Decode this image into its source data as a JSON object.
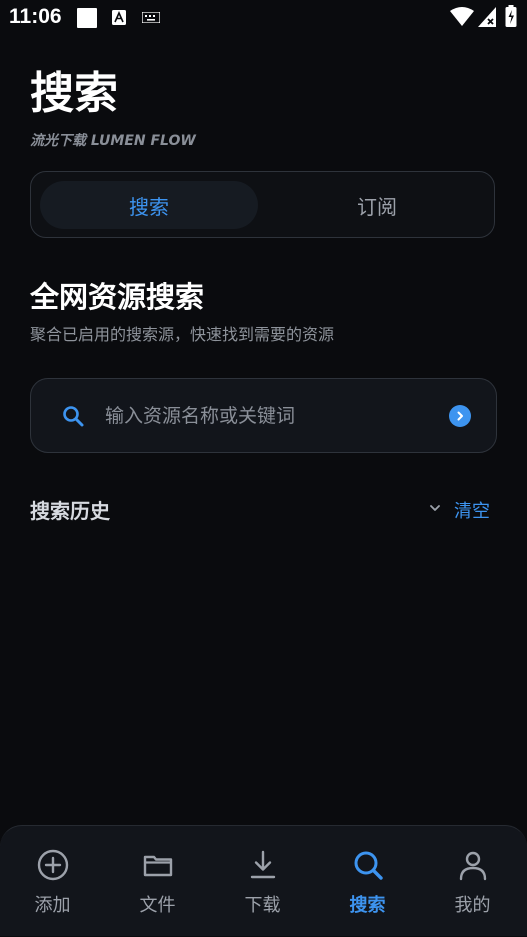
{
  "status_bar": {
    "time": "11:06"
  },
  "header": {
    "title": "搜索",
    "subtitle": "流光下载 LUMEN FLOW"
  },
  "tabs": [
    {
      "label": "搜索",
      "active": true
    },
    {
      "label": "订阅",
      "active": false
    }
  ],
  "section": {
    "title": "全网资源搜索",
    "description": "聚合已启用的搜索源，快速找到需要的资源"
  },
  "search": {
    "placeholder": "输入资源名称或关键词",
    "value": ""
  },
  "history": {
    "title": "搜索历史",
    "clear_label": "清空"
  },
  "bottom_nav": [
    {
      "label": "添加",
      "icon": "add-circle-icon",
      "active": false
    },
    {
      "label": "文件",
      "icon": "folder-icon",
      "active": false
    },
    {
      "label": "下载",
      "icon": "download-icon",
      "active": false
    },
    {
      "label": "搜索",
      "icon": "search-icon",
      "active": true
    },
    {
      "label": "我的",
      "icon": "person-icon",
      "active": false
    }
  ],
  "colors": {
    "accent": "#3d94f0",
    "background": "#0a0b0e",
    "muted": "#9ca1aa"
  }
}
